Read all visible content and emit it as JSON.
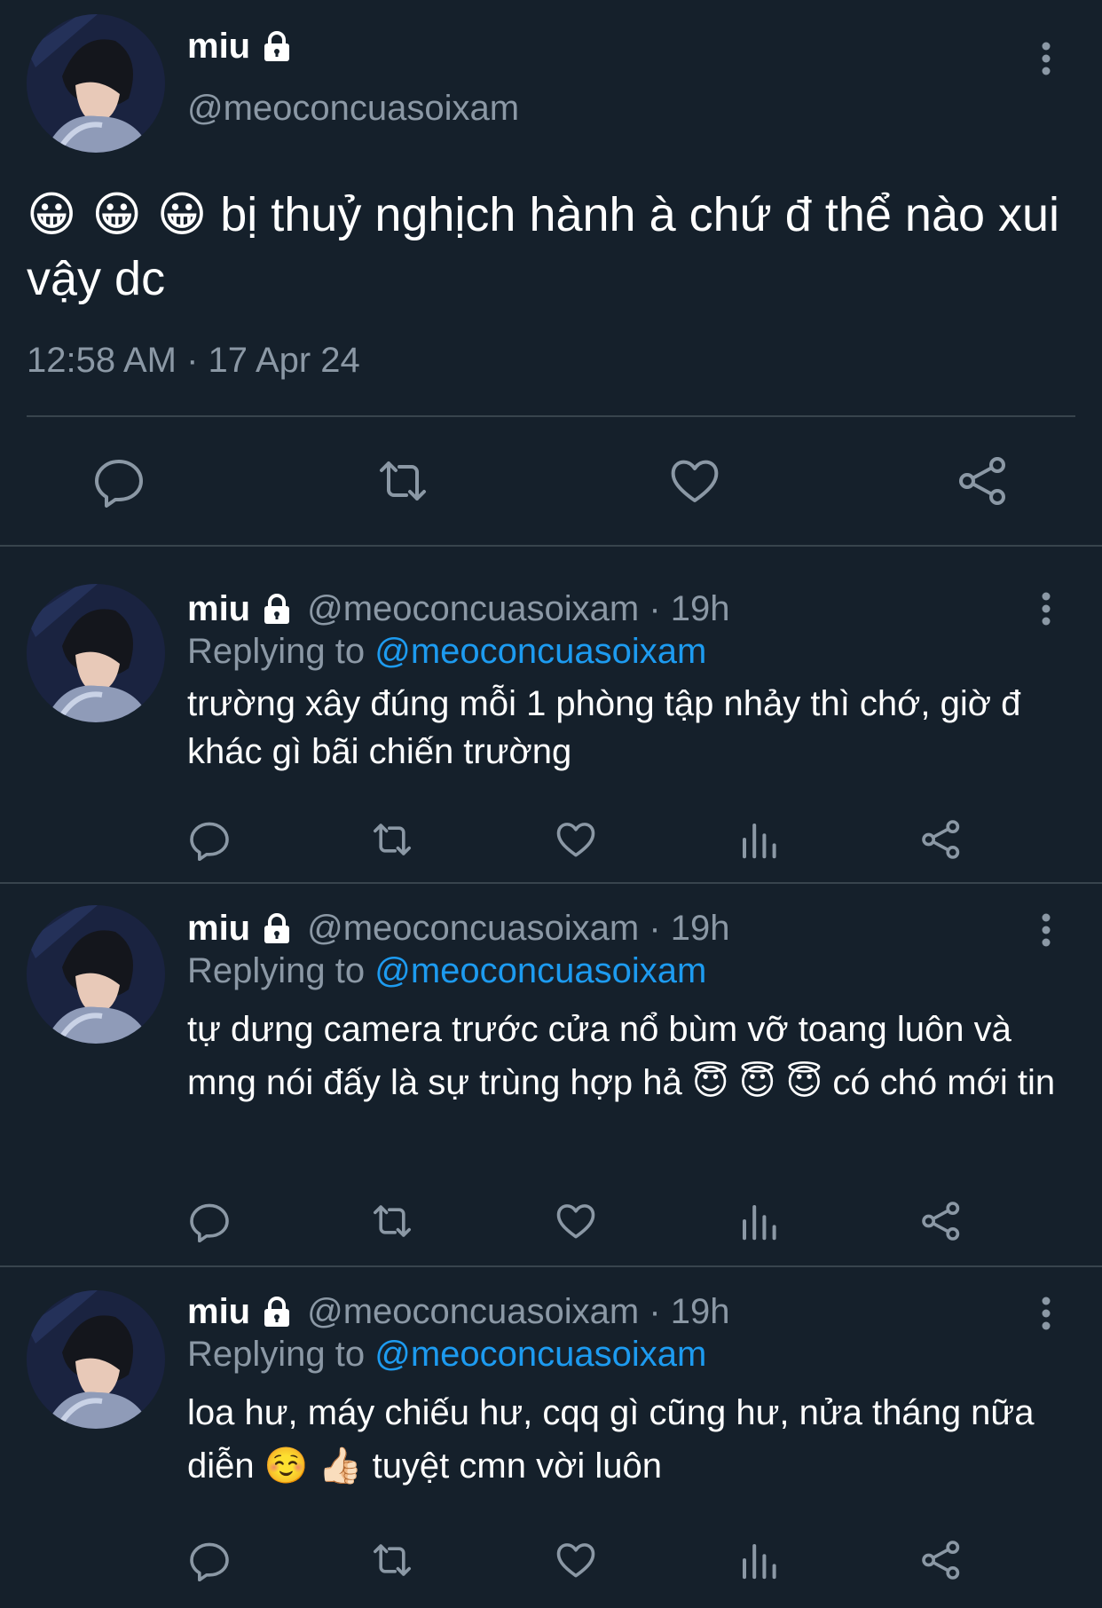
{
  "main_tweet": {
    "name": "miu",
    "handle": "@meoconcuasoixam",
    "text_emoji": "😀 😀 😀",
    "text": " bị thuỷ nghịch hành à chứ đ thể nào xui vậy dc",
    "timestamp": "12:58 AM · 17 Apr 24",
    "actions": [
      "reply-icon",
      "retweet-icon",
      "like-icon",
      "share-icon"
    ]
  },
  "replies": [
    {
      "name": "miu",
      "meta": "@meoconcuasoixam · 19h",
      "replying_prefix": "Replying to ",
      "replying_handle": "@meoconcuasoixam",
      "text": "trường xây đúng mỗi 1 phòng tập nhảy thì chớ, giờ đ khác gì bãi chiến trường"
    },
    {
      "name": "miu",
      "meta": "@meoconcuasoixam · 19h",
      "replying_prefix": "Replying to ",
      "replying_handle": "@meoconcuasoixam",
      "text": "tự dưng camera trước cửa nổ bùm vỡ toang luôn và mng nói đấy là sự trùng hợp hả 😇 😇 😇  có chó mới tin"
    },
    {
      "name": "miu",
      "meta": "@meoconcuasoixam · 19h",
      "replying_prefix": "Replying to ",
      "replying_handle": "@meoconcuasoixam",
      "text": "loa hư, máy chiếu hư, cqq gì cũng hư, nửa tháng nữa diễn ☺️ 👍🏻  tuyệt cmn vời luôn"
    }
  ],
  "colors": {
    "background": "#15202b",
    "text": "#ffffff",
    "secondary": "#8b98a5",
    "link": "#1d9bf0",
    "divider": "#38444d"
  }
}
